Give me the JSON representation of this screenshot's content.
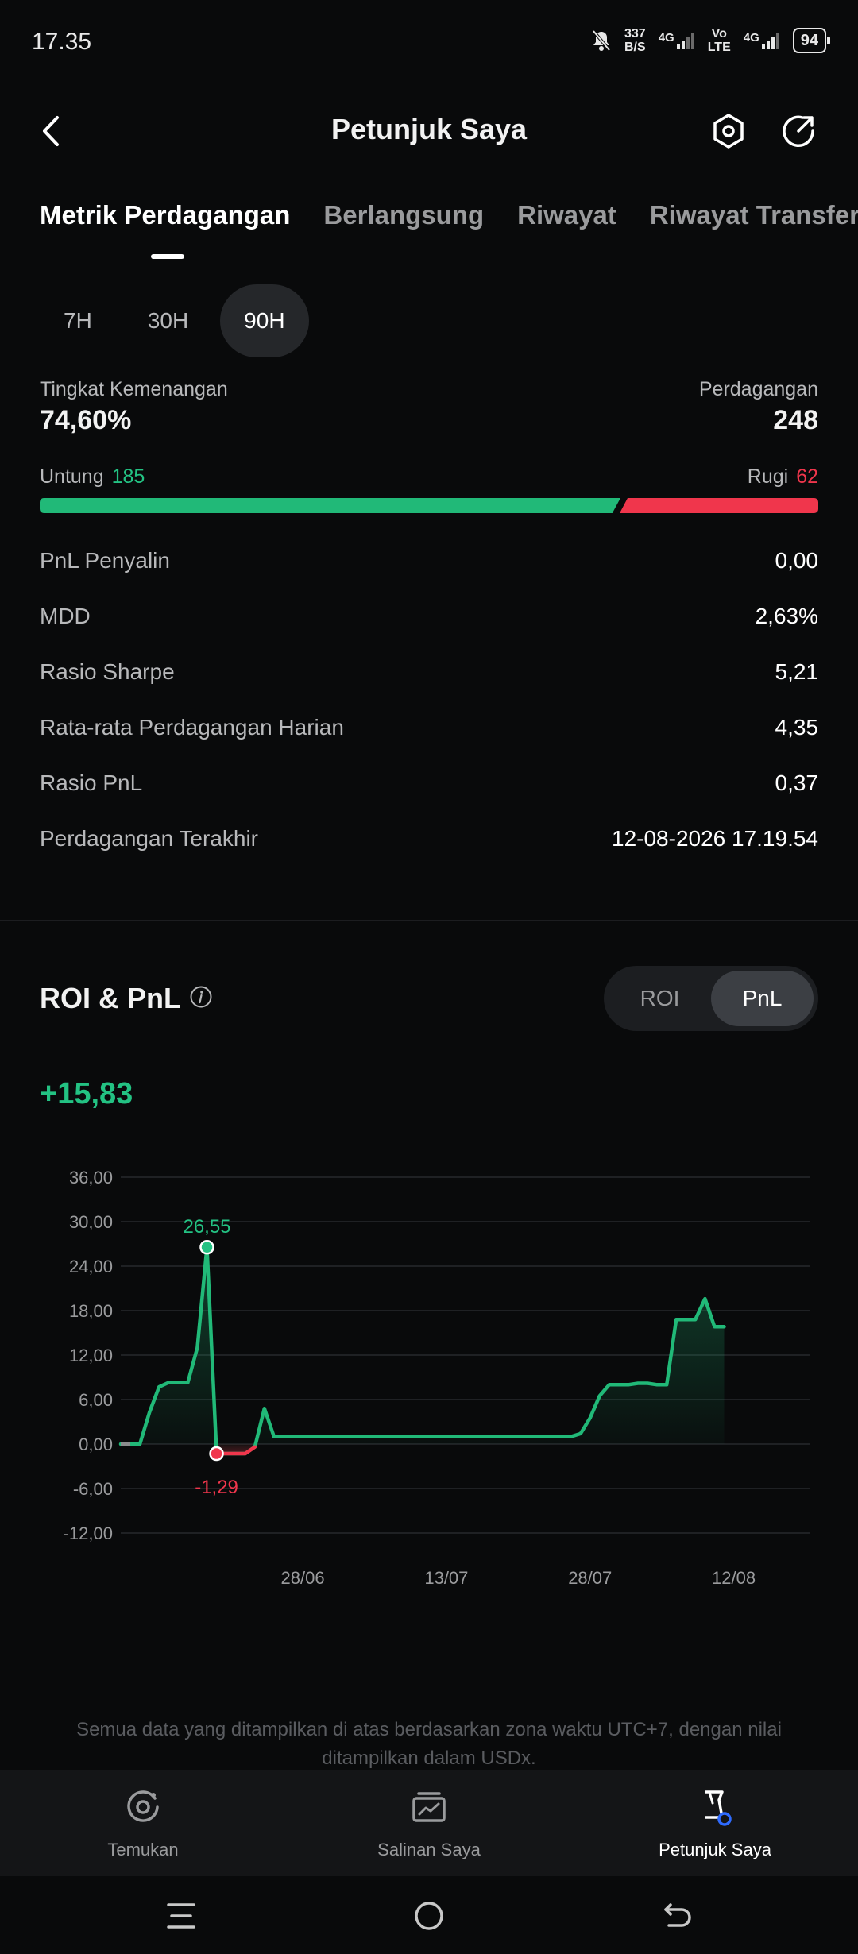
{
  "status_bar": {
    "time": "17.35",
    "net_speed_top": "337",
    "net_speed_bottom": "B/S",
    "net1": "4G",
    "volte_top": "Vo",
    "volte_bottom": "LTE",
    "net2": "4G",
    "battery": "94"
  },
  "header": {
    "title": "Petunjuk Saya"
  },
  "tabs": [
    {
      "label": "Metrik Perdagangan",
      "active": true
    },
    {
      "label": "Berlangsung",
      "active": false
    },
    {
      "label": "Riwayat",
      "active": false
    },
    {
      "label": "Riwayat Transfer",
      "active": false
    }
  ],
  "periods": [
    {
      "label": "7H",
      "active": false
    },
    {
      "label": "30H",
      "active": false
    },
    {
      "label": "90H",
      "active": true
    }
  ],
  "summary": {
    "winrate_label": "Tingkat Kemenangan",
    "winrate_value": "74,60%",
    "trades_label": "Perdagangan",
    "trades_value": "248",
    "profit_label": "Untung",
    "profit_count": "185",
    "loss_label": "Rugi",
    "loss_count": "62",
    "profit_ratio": 0.746
  },
  "metrics": [
    {
      "label": "PnL Penyalin",
      "value": "0,00"
    },
    {
      "label": "MDD",
      "value": "2,63%"
    },
    {
      "label": "Rasio Sharpe",
      "value": "5,21"
    },
    {
      "label": "Rata-rata Perdagangan Harian",
      "value": "4,35"
    },
    {
      "label": "Rasio PnL",
      "value": "0,37"
    },
    {
      "label": "Perdagangan Terakhir",
      "value": "12-08-2026 17.19.54"
    }
  ],
  "roi_section": {
    "title": "ROI & PnL",
    "toggle": [
      {
        "label": "ROI",
        "active": false
      },
      {
        "label": "PnL",
        "active": true
      }
    ],
    "current_value": "+15,83"
  },
  "chart_data": {
    "type": "area",
    "y_ticks": [
      "36,00",
      "30,00",
      "24,00",
      "18,00",
      "12,00",
      "6,00",
      "0,00",
      "-6,00",
      "-12,00"
    ],
    "ylim": [
      -12,
      36
    ],
    "x_ticks": [
      {
        "label": "28/06",
        "day": 20
      },
      {
        "label": "13/07",
        "day": 35
      },
      {
        "label": "28/07",
        "day": 50
      },
      {
        "label": "12/08",
        "day": 65
      }
    ],
    "x_domain": [
      1,
      73
    ],
    "grid": true,
    "series_color": "#21b978",
    "negative_color": "#f0364c",
    "annotations": [
      {
        "label": "26,55",
        "day": 15,
        "value": 26.55,
        "color": "#23c283"
      },
      {
        "label": "-1,29",
        "day": 16,
        "value": -1.29,
        "color": "#f0364c"
      }
    ],
    "points": [
      [
        1,
        0
      ],
      [
        2,
        0
      ],
      [
        3,
        0
      ],
      [
        4,
        4.3
      ],
      [
        5,
        7.7
      ],
      [
        6,
        8.3
      ],
      [
        7,
        8.3
      ],
      [
        8,
        8.3
      ],
      [
        9,
        13
      ],
      [
        10,
        26.55
      ],
      [
        11,
        -1.29
      ],
      [
        12,
        -1.29
      ],
      [
        13,
        -1.29
      ],
      [
        14,
        -1.29
      ],
      [
        15,
        -0.4
      ],
      [
        16,
        4.8
      ],
      [
        17,
        1.0
      ],
      [
        18,
        1.0
      ],
      [
        19,
        1.0
      ],
      [
        20,
        1.0
      ],
      [
        25,
        1.0
      ],
      [
        30,
        1.0
      ],
      [
        35,
        1.0
      ],
      [
        40,
        1.0
      ],
      [
        45,
        1.0
      ],
      [
        48,
        1.0
      ],
      [
        49,
        1.4
      ],
      [
        50,
        3.5
      ],
      [
        51,
        6.5
      ],
      [
        52,
        8.0
      ],
      [
        53,
        8.0
      ],
      [
        54,
        8.0
      ],
      [
        55,
        8.2
      ],
      [
        56,
        8.2
      ],
      [
        57,
        8.0
      ],
      [
        58,
        8.0
      ],
      [
        59,
        16.8
      ],
      [
        60,
        16.8
      ],
      [
        61,
        16.8
      ],
      [
        62,
        19.6
      ],
      [
        63,
        15.83
      ],
      [
        64,
        15.83
      ]
    ]
  },
  "footnote": "Semua data yang ditampilkan di atas berdasarkan zona waktu UTC+7, dengan nilai ditampilkan dalam USDx.",
  "bottom_nav": [
    {
      "label": "Temukan",
      "icon": "discover-icon",
      "active": false
    },
    {
      "label": "Salinan Saya",
      "icon": "chart-board-icon",
      "active": false
    },
    {
      "label": "Petunjuk Saya",
      "icon": "trader-hat-icon",
      "active": true
    }
  ],
  "colors": {
    "background": "#090a0b",
    "profit": "#23c283",
    "loss": "#f0364c",
    "accent_blue": "#2f6bff"
  }
}
